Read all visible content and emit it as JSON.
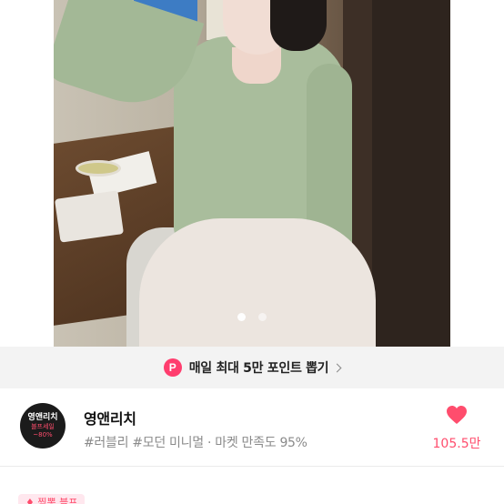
{
  "product": {
    "image_alt": "상품 이미지",
    "carousel": {
      "total": 2,
      "active": 1
    }
  },
  "banner": {
    "badge": "P",
    "text": "매일 최대 5만 포인트 뽑기",
    "accent": "#ff3d6e"
  },
  "shop": {
    "logo_line1": "영앤리치",
    "logo_line2": "블프세일",
    "logo_line3": "~80%",
    "name": "영앤리치",
    "tags": "#러블리 #모던 미니멀 · 마켓 만족도 95%",
    "like_count": "105.5만",
    "like_color": "#ff4d6d"
  },
  "bottom": {
    "tag": "♦ 찜뽕 블프"
  }
}
